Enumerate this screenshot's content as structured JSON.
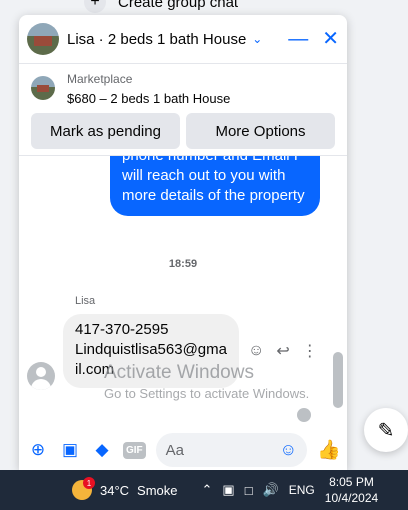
{
  "background": {
    "top_text": "Create group chat"
  },
  "chat": {
    "title": "Lisa · 2 beds 1 bath House",
    "marketplace_label": "Marketplace",
    "listing": "$680 – 2 beds 1 bath House",
    "buttons": {
      "pending": "Mark as pending",
      "more": "More Options"
    }
  },
  "messages": {
    "outgoing": "phone number and Email I will reach out to you with more details of the property",
    "timestamp": "18:59",
    "sender": "Lisa",
    "incoming_phone": "417-370-2595",
    "incoming_email": "Lindquistlisa563@gmail.com"
  },
  "composer": {
    "placeholder": "Aa",
    "gif_label": "GIF"
  },
  "watermark": {
    "line1": "Activate Windows",
    "line2": "Go to Settings to activate Windows."
  },
  "taskbar": {
    "weather_badge": "1",
    "temperature": "34°C",
    "condition": "Smoke",
    "language": "ENG",
    "time": "8:05 PM",
    "date": "10/4/2024"
  },
  "colors": {
    "accent": "#0866ff",
    "taskbar": "#1f2a3a"
  }
}
